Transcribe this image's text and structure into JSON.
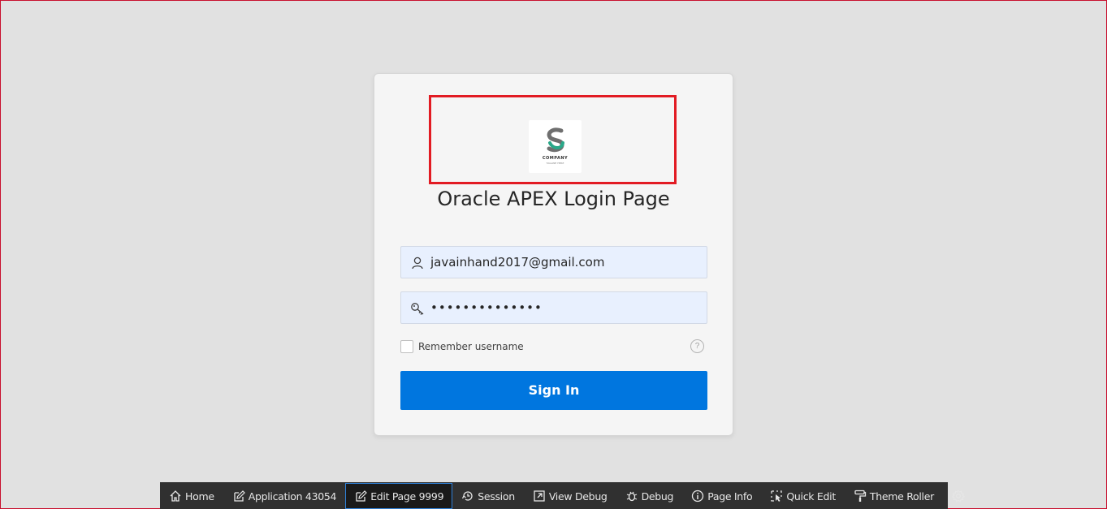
{
  "page": {
    "title": "Oracle APEX Login Page"
  },
  "logo": {
    "company": "COMPANY",
    "tagline": "TAGLINE HERE"
  },
  "login": {
    "username_value": "javainhand2017@gmail.com",
    "password_value": "••••••••••••••",
    "remember_label": "Remember username",
    "help_glyph": "?",
    "signin_label": "Sign In"
  },
  "dev_toolbar": {
    "items": [
      {
        "label": "Home",
        "icon": "home-icon"
      },
      {
        "label": "Application 43054",
        "icon": "edit-icon"
      },
      {
        "label": "Edit Page 9999",
        "icon": "edit-icon"
      },
      {
        "label": "Session",
        "icon": "session-icon"
      },
      {
        "label": "View Debug",
        "icon": "view-debug-icon"
      },
      {
        "label": "Debug",
        "icon": "bug-icon"
      },
      {
        "label": "Page Info",
        "icon": "info-icon"
      },
      {
        "label": "Quick Edit",
        "icon": "quick-edit-icon"
      },
      {
        "label": "Theme Roller",
        "icon": "paint-roller-icon"
      },
      {
        "label": "",
        "icon": "gear-icon"
      }
    ]
  },
  "colors": {
    "background": "#e1e1e1",
    "accent": "#0076df",
    "highlight_frame": "#e21b23",
    "toolbar": "#303030"
  }
}
